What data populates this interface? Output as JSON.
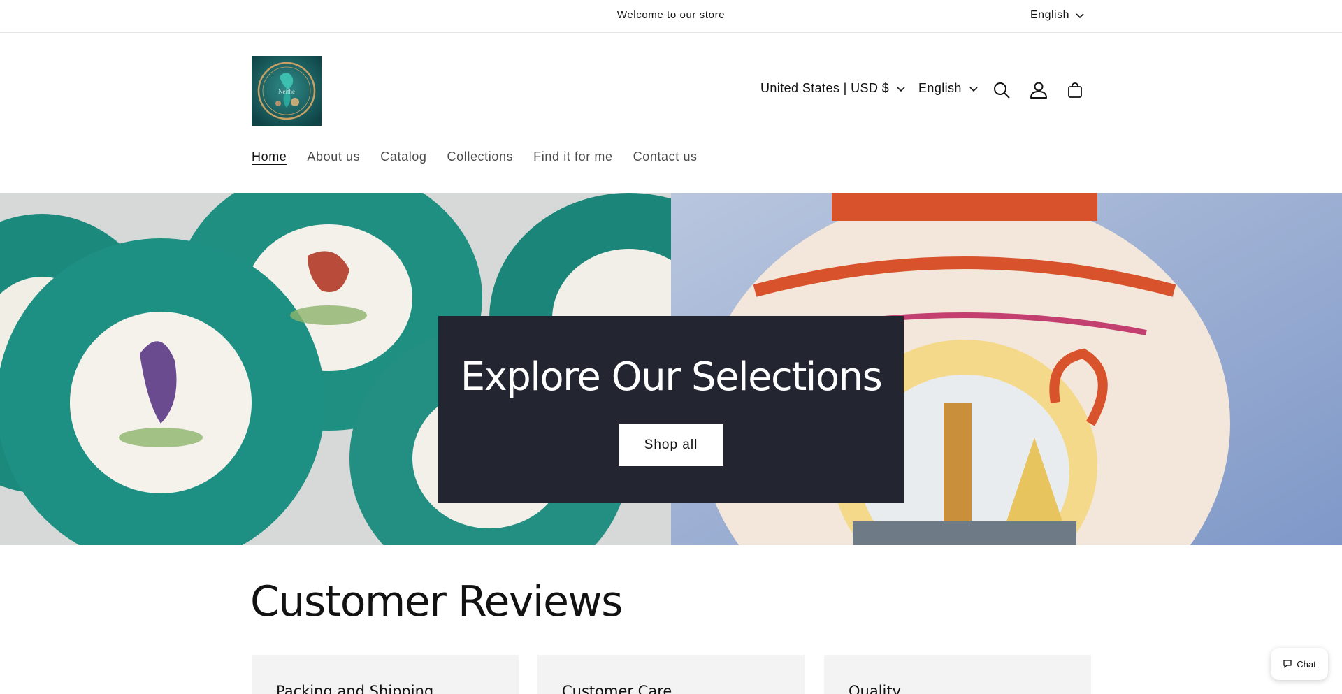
{
  "announcement": {
    "text": "Welcome to our store",
    "language": "English"
  },
  "header": {
    "logo_text": "Neithé",
    "country": "United States | USD $",
    "language": "English",
    "icons": [
      "search-icon",
      "account-icon",
      "cart-icon"
    ]
  },
  "nav": {
    "items": [
      {
        "label": "Home",
        "active": true
      },
      {
        "label": "About us",
        "active": false
      },
      {
        "label": "Catalog",
        "active": false
      },
      {
        "label": "Collections",
        "active": false
      },
      {
        "label": "Find it for me",
        "active": false
      },
      {
        "label": "Contact us",
        "active": false
      }
    ]
  },
  "hero": {
    "title": "Explore Our Selections",
    "button_label": "Shop all"
  },
  "reviews": {
    "title": "Customer Reviews",
    "cards": [
      {
        "title": "Packing and Shipping"
      },
      {
        "title": "Customer Care"
      },
      {
        "title": "Quality"
      }
    ]
  },
  "chat": {
    "label": "Chat"
  },
  "colors": {
    "hero_box": "#232631",
    "text": "#121212",
    "card_bg": "#f3f3f3"
  }
}
